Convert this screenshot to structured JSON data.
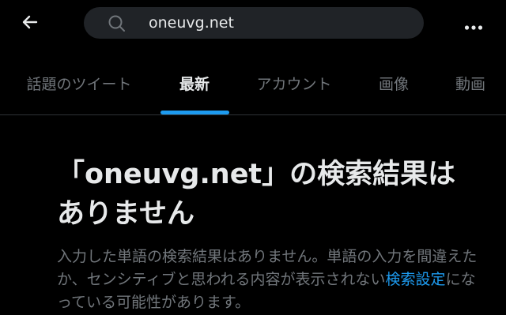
{
  "header": {
    "back_icon": "arrow-left-icon",
    "search": {
      "icon": "search-icon",
      "value": "oneuvg.net"
    },
    "more_icon": "more-horizontal-icon"
  },
  "tabs": [
    {
      "label": "話題のツイート",
      "active": false
    },
    {
      "label": "最新",
      "active": true
    },
    {
      "label": "アカウント",
      "active": false
    },
    {
      "label": "画像",
      "active": false
    },
    {
      "label": "動画",
      "active": false
    }
  ],
  "empty_state": {
    "title": "「oneuvg.net」の検索結果はありません",
    "description_before": "入力した単語の検索結果はありません。単語の入力を間違えたか、センシティブと思われる内容が表示されない",
    "description_link": "検索設定",
    "description_after": "になっている可能性があります。"
  },
  "colors": {
    "background": "#000000",
    "text_primary": "#e7e9ea",
    "text_secondary": "#71767b",
    "accent": "#1d9bf0",
    "search_bg": "#202327"
  }
}
